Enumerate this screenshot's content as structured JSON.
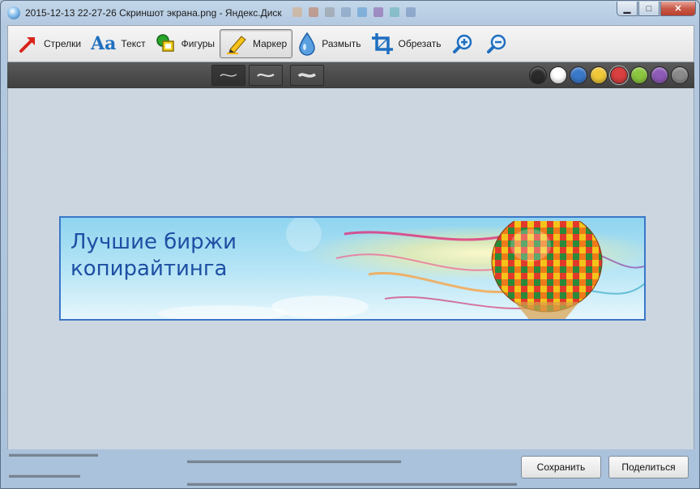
{
  "window": {
    "title": "2015-12-13 22-27-26 Скриншот экрана.png - Яндекс.Диск",
    "minimize": "▁",
    "maximize": "□",
    "close": "✕"
  },
  "toolbar": {
    "tools": [
      {
        "label": "Стрелки",
        "icon": "arrow-icon"
      },
      {
        "label": "Текст",
        "icon": "text-icon"
      },
      {
        "label": "Фигуры",
        "icon": "shapes-icon"
      },
      {
        "label": "Маркер",
        "icon": "marker-icon",
        "active": true
      },
      {
        "label": "Размыть",
        "icon": "blur-drop-icon"
      },
      {
        "label": "Обрезать",
        "icon": "crop-icon"
      }
    ],
    "zoom_in": "zoom-in-icon",
    "zoom_out": "zoom-out-icon",
    "text_icon_glyph": "Aa"
  },
  "stroke_options": [
    "thin",
    "medium",
    "thick"
  ],
  "stroke_glyphs": [
    "∼",
    "∼",
    "∼"
  ],
  "palette": {
    "colors": [
      "#2b2b2b",
      "#ffffff",
      "#3a78c8",
      "#f0c838",
      "#d94040",
      "#8cc63f",
      "#8e5bb8",
      "#8a8a8a"
    ],
    "selected_index": 4
  },
  "banner": {
    "title_line1": "Лучшие биржи",
    "title_line2": "копирайтинга"
  },
  "buttons": {
    "save": "Сохранить",
    "share": "Поделиться"
  }
}
